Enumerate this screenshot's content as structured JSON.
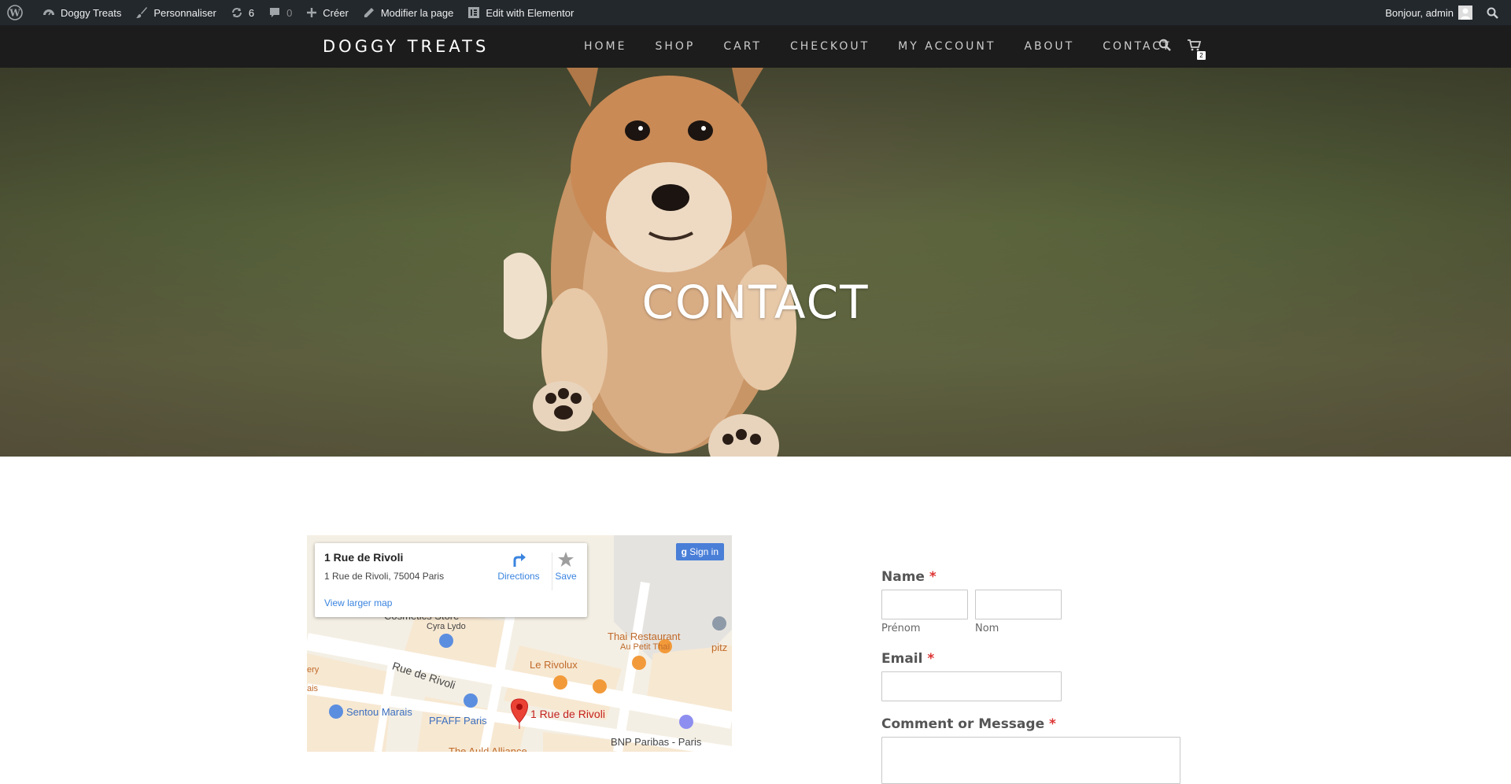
{
  "admin_bar": {
    "wp_logo_icon": "wordpress-icon",
    "site_name": "Doggy Treats",
    "customize": "Personnaliser",
    "updates_count": "6",
    "comments_count": "0",
    "new": "Créer",
    "edit_page": "Modifier la page",
    "elementor": "Edit with Elementor",
    "greeting": "Bonjour, admin"
  },
  "header": {
    "logo": "DOGGY TREATS",
    "nav": [
      "HOME",
      "SHOP",
      "CART",
      "CHECKOUT",
      "MY ACCOUNT",
      "ABOUT",
      "CONTACT"
    ],
    "cart_count": "2"
  },
  "hero": {
    "title": "CONTACT"
  },
  "map": {
    "place_title": "1 Rue de Rivoli",
    "place_address": "1 Rue de Rivoli, 75004 Paris",
    "view_larger": "View larger map",
    "directions": "Directions",
    "save": "Save",
    "sign_in": "Sign in",
    "labels": {
      "cosmetics": "Cosmetics Store",
      "cyra": "Cyra Lydo",
      "thai": "Thai Restaurant",
      "au_petit": "Au Petit Thaï",
      "pitz": "pitz",
      "rivolux": "Le Rivolux",
      "rue": "Rue de Rivoli",
      "sentou": "Sentou Marais",
      "pfaff": "PFAFF Paris",
      "pin": "1 Rue de Rivoli",
      "bnp": "BNP Paribas - Paris",
      "auld": "The Auld Alliance",
      "ery": "ery",
      "ais": "ais"
    }
  },
  "form": {
    "name_label": "Name",
    "first_sub": "Prénom",
    "last_sub": "Nom",
    "email_label": "Email",
    "comment_label": "Comment or Message",
    "required_mark": "*"
  }
}
